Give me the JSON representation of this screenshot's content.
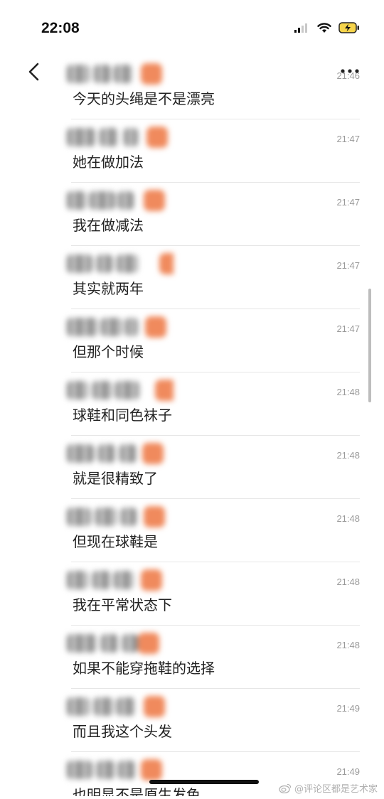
{
  "status_bar": {
    "time": "22:08"
  },
  "header": {
    "back_icon": "chevron-left-icon",
    "more_icon": "more-dots-icon"
  },
  "messages": [
    {
      "text": "今天的头绳是不是漂亮",
      "time": "21:46"
    },
    {
      "text": "她在做加法",
      "time": "21:47"
    },
    {
      "text": "我在做减法",
      "time": "21:47"
    },
    {
      "text": "其实就两年",
      "time": "21:47"
    },
    {
      "text": "但那个时候",
      "time": "21:47"
    },
    {
      "text": "球鞋和同色袜子",
      "time": "21:48"
    },
    {
      "text": "就是很精致了",
      "time": "21:48"
    },
    {
      "text": "但现在球鞋是",
      "time": "21:48"
    },
    {
      "text": "我在平常状态下",
      "time": "21:48"
    },
    {
      "text": "如果不能穿拖鞋的选择",
      "time": "21:48"
    },
    {
      "text": "而且我这个头发",
      "time": "21:49"
    },
    {
      "text": "也明显不是原生发色",
      "time": "21:49"
    }
  ],
  "watermark": {
    "text": "@评论区都是艺术家"
  },
  "colors": {
    "divider": "#e6e6e6",
    "timestamp": "#9a9a9a",
    "blur_orange": "#f08a5d"
  }
}
